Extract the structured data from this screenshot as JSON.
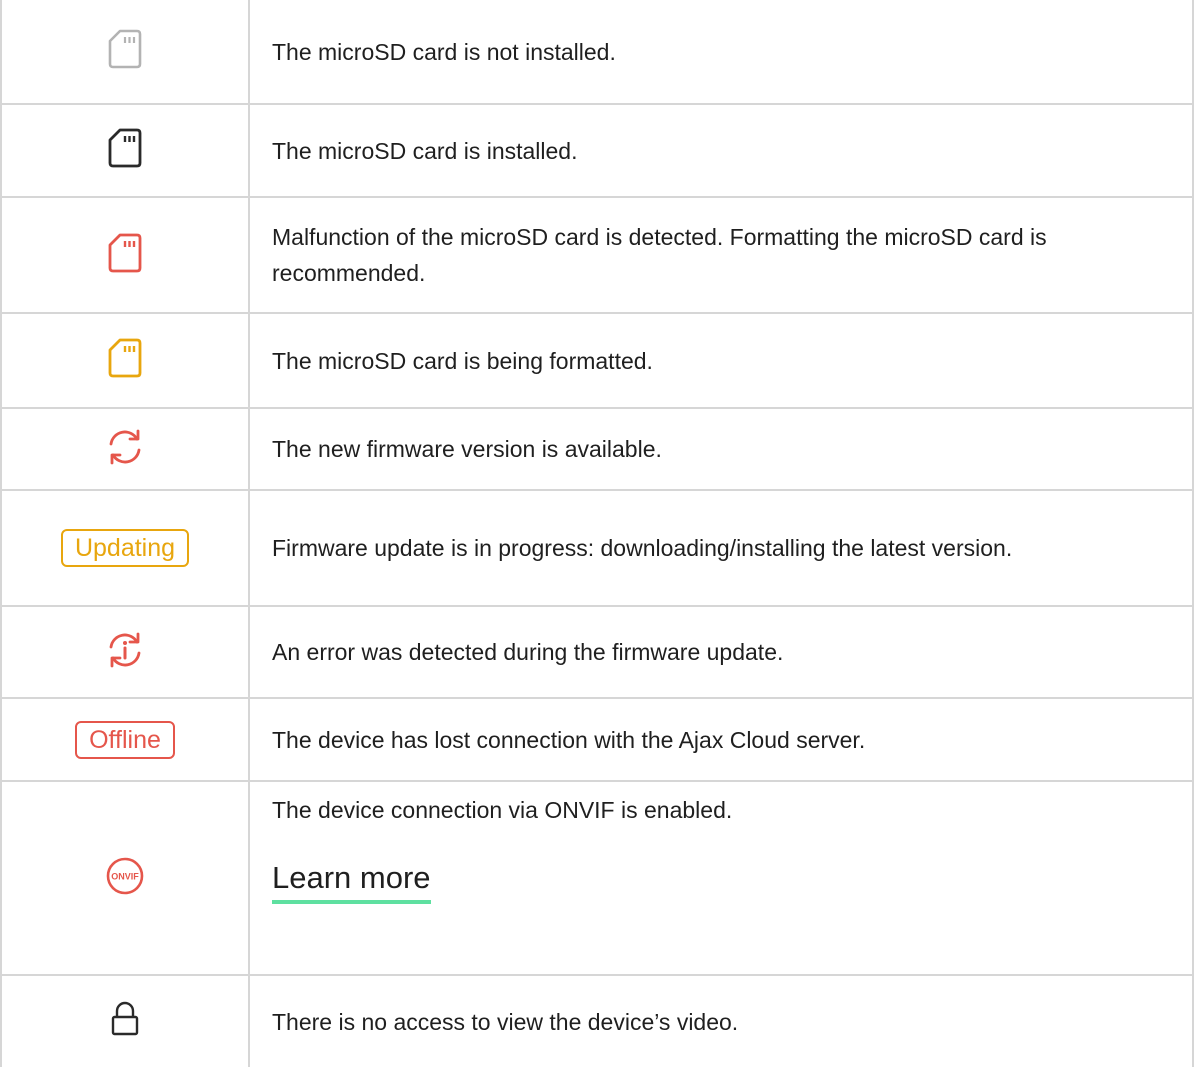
{
  "rows": [
    {
      "icon": "sdcard-not-installed-icon",
      "text": "The microSD card is not installed."
    },
    {
      "icon": "sdcard-installed-icon",
      "text": "The microSD card is installed."
    },
    {
      "icon": "sdcard-malfunction-icon",
      "text": "Malfunction of the microSD card is detected. Formatting the microSD card is recommended."
    },
    {
      "icon": "sdcard-formatting-icon",
      "text": "The microSD card is being formatted."
    },
    {
      "icon": "firmware-update-available-icon",
      "text": "The new firmware version is available."
    },
    {
      "badge": "Updating",
      "text": "Firmware update is in progress: downloading/installing the latest version."
    },
    {
      "icon": "firmware-update-error-icon",
      "text": "An error was detected during the firmware update."
    },
    {
      "badge": "Offline",
      "text": "The device has lost connection with the Ajax Cloud server."
    },
    {
      "icon": "onvif-icon",
      "icon_text": "ONVIF",
      "text": "The device connection via ONVIF is enabled.",
      "link": "Learn more"
    },
    {
      "icon": "lock-icon",
      "text": "There is no access to view the device’s video."
    }
  ],
  "colors": {
    "gray": "#b3b3b3",
    "dark": "#2a2a2a",
    "red": "#e5564b",
    "yellow": "#e8a60e",
    "link_underline": "#5ee0a0",
    "border": "#d6d6d6"
  }
}
